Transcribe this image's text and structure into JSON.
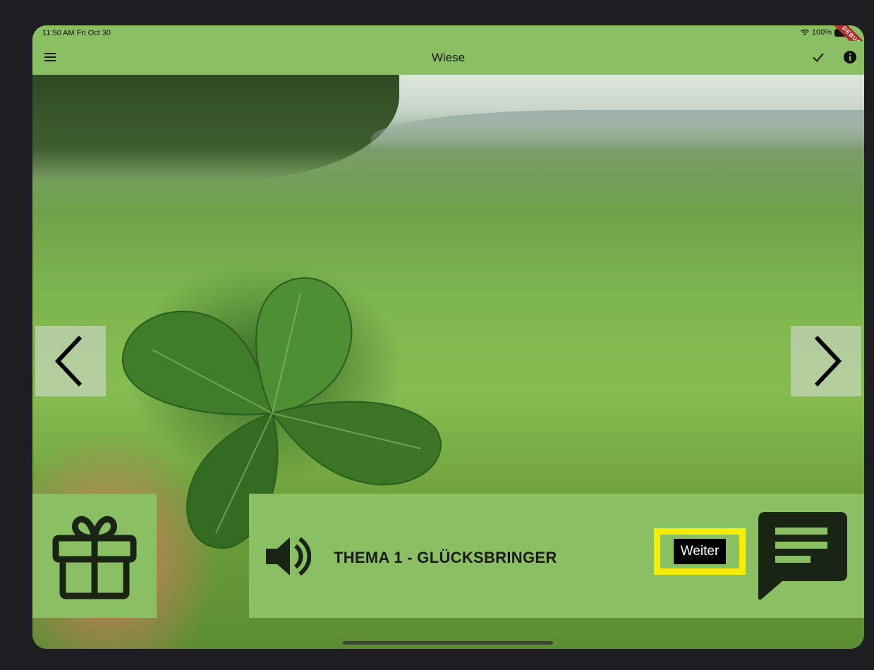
{
  "status_bar": {
    "time": "11:50 AM  Fri Oct 30",
    "battery": "100%",
    "debug_ribbon": "DEBUG"
  },
  "app_bar": {
    "title": "Wiese"
  },
  "panel": {
    "topic_title": "THEMA 1 - GLÜCKSBRINGER",
    "next_button_label": "Weiter"
  },
  "colors": {
    "accent_green": "#8bbf63",
    "highlight_yellow": "#f4ee00",
    "icon_dark": "#1a1a1a"
  },
  "icons": {
    "menu": "hamburger-menu-icon",
    "check": "checkmark-icon",
    "info": "info-icon",
    "prev": "chevron-left-icon",
    "next": "chevron-right-icon",
    "gift": "gift-icon",
    "speaker": "speaker-icon",
    "chat": "chat-message-icon"
  }
}
